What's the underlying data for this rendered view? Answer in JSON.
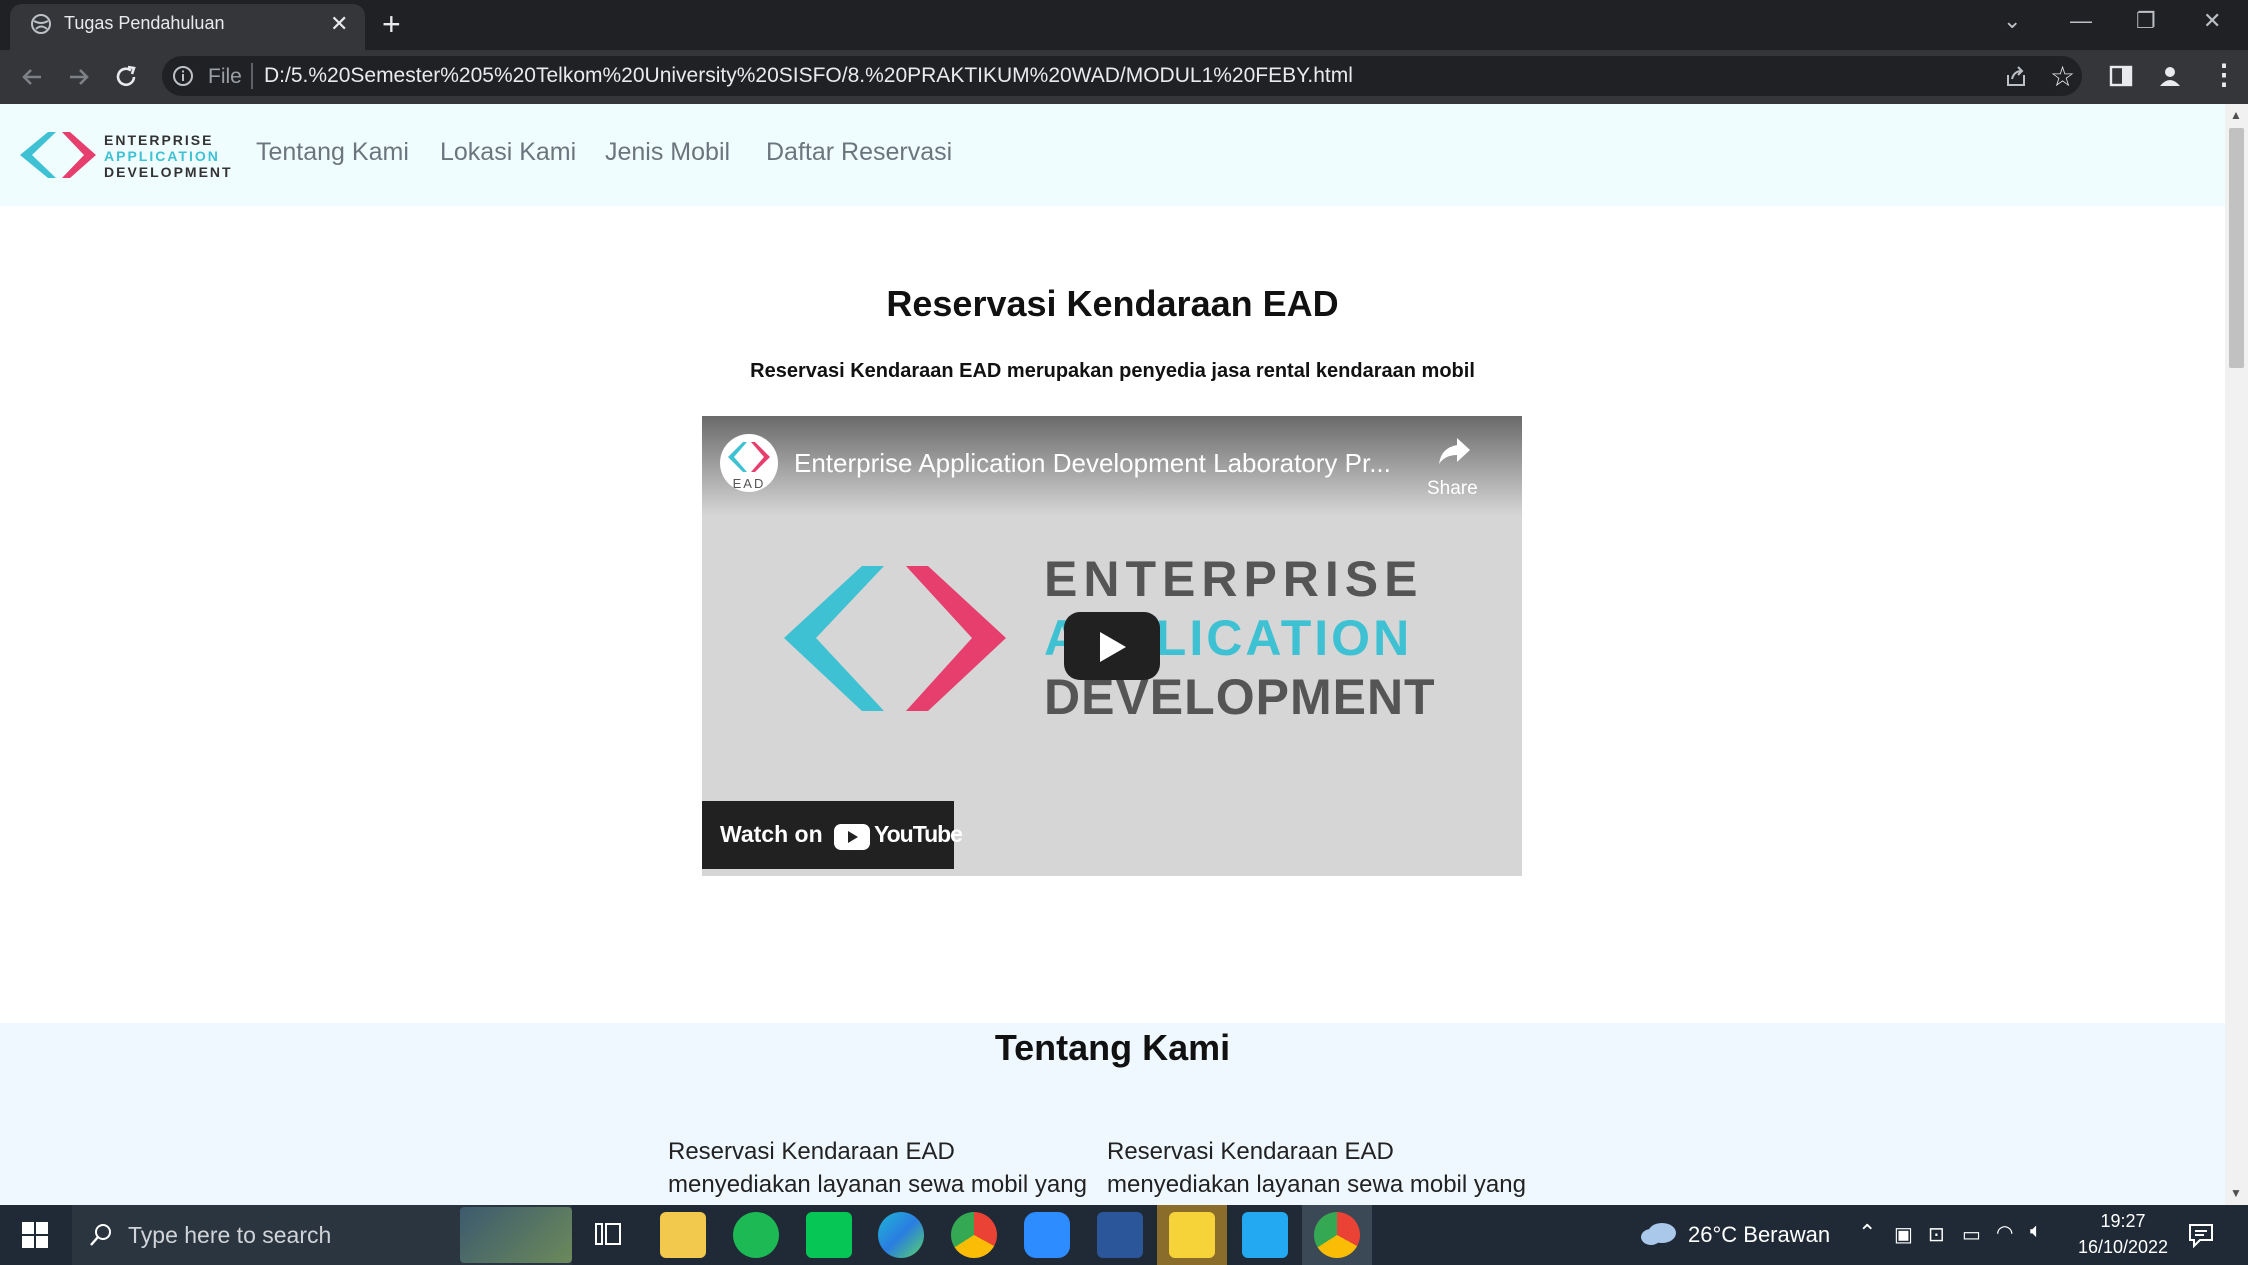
{
  "browser": {
    "tab_title": "Tugas Pendahuluan",
    "file_label": "File",
    "url": "D:/5.%20Semester%205%20Telkom%20University%20SISFO/8.%20PRAKTIKUM%20WAD/MODUL1%20FEBY.html"
  },
  "logo": {
    "line1": "ENTERPRISE",
    "line2": "APPLICATION",
    "line3": "DEVELOPMENT",
    "colors": {
      "cyan": "#3ec1d3",
      "pink": "#e63e6d",
      "dark": "#333333"
    }
  },
  "nav": {
    "items": [
      "Tentang Kami",
      "Lokasi Kami",
      "Jenis Mobil",
      "Daftar Reservasi"
    ]
  },
  "hero": {
    "title": "Reservasi Kendaraan EAD",
    "subtitle": "Reservasi Kendaraan EAD merupakan penyedia jasa rental kendaraan mobil"
  },
  "video": {
    "channel_badge": "EAD",
    "title": "Enterprise Application Development Laboratory Pr...",
    "share_label": "Share",
    "thumb_line1": "ENTERPRISE",
    "thumb_line2": "APPLICATION",
    "thumb_line3": "DEVELOPMENT",
    "watch_on": "Watch on",
    "youtube": "YouTube"
  },
  "about": {
    "title": "Tentang Kami",
    "col1": "Reservasi Kendaraan EAD menyediakan layanan sewa mobil yang berdomisili di",
    "col2": "Reservasi Kendaraan EAD menyediakan layanan sewa mobil yang berdomisili di"
  },
  "taskbar": {
    "search_placeholder": "Type here to search",
    "weather": "26°C  Berawan",
    "time": "19:27",
    "date": "16/10/2022"
  }
}
